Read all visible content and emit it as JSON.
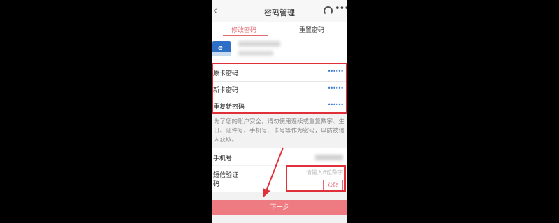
{
  "header": {
    "back_icon": "back-icon",
    "title": "密码管理"
  },
  "tabs": [
    {
      "label": "修改密码",
      "active": true
    },
    {
      "label": "重置密码",
      "active": false
    }
  ],
  "card": {
    "icon": "bank-card-icon"
  },
  "password_fields": [
    {
      "label": "原卡密码",
      "value": "••••••"
    },
    {
      "label": "新卡密码",
      "value": "••••••"
    },
    {
      "label": "重复新密码",
      "value": "••••••"
    }
  ],
  "notice": "为了您的账户安全，请勿使用连续或重复数字、生日、证件号、手机号、卡号等作为密码，以防被他人获取。",
  "phone_field": {
    "label": "手机号"
  },
  "sms_field": {
    "label_line1": "短信验证",
    "label_line2": "码",
    "placeholder": "请输入6位数字",
    "get_button": "获取"
  },
  "next_button": "下一步",
  "colors": {
    "accent": "#e06b74",
    "highlight_box": "#e0313b",
    "button": "#ee7b82",
    "dots": "#3a7bd5"
  }
}
